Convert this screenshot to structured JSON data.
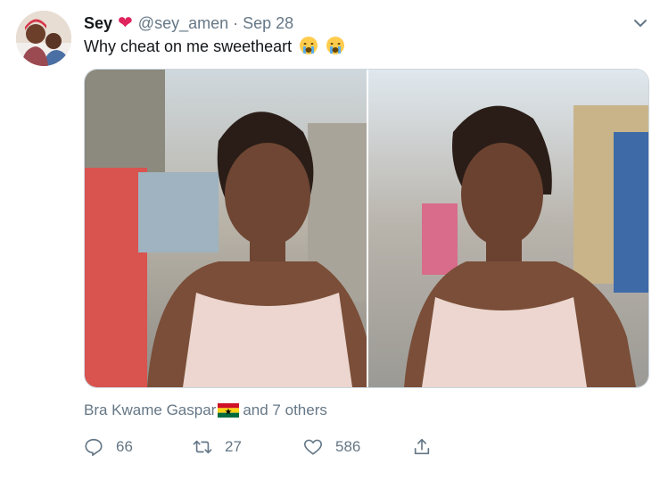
{
  "tweet": {
    "name": "Sey",
    "heart": "❤",
    "handle": "@sey_amen",
    "separator": "·",
    "date": "Sep 28",
    "text": "Why cheat on me sweetheart"
  },
  "liked_by": {
    "user": "Bra Kwame Gaspar",
    "others": "and 7 others"
  },
  "actions": {
    "replies": "66",
    "retweets": "27",
    "likes": "586"
  },
  "icons": {
    "menu": "chevron-down-icon",
    "emoji": "crying-face-emoji-icon",
    "flag": "ghana-flag-icon",
    "reply": "reply-icon",
    "retweet": "retweet-icon",
    "like": "heart-icon",
    "share": "share-icon"
  },
  "colors": {
    "text": "#14171a",
    "secondary": "#657786",
    "heart": "#e0245e",
    "border": "#ccd6dd"
  }
}
